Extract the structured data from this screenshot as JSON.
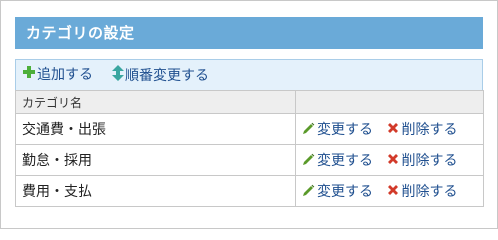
{
  "header": {
    "title": "カテゴリの設定"
  },
  "toolbar": {
    "add_label": "追加する",
    "order_label": "順番変更する"
  },
  "table": {
    "column_header": "カテゴリ名",
    "rows": [
      {
        "name": "交通費・出張",
        "edit_label": "変更する",
        "delete_label": "削除する"
      },
      {
        "name": "勤怠・採用",
        "edit_label": "変更する",
        "delete_label": "削除する"
      },
      {
        "name": "費用・支払",
        "edit_label": "変更する",
        "delete_label": "削除する"
      }
    ]
  },
  "icons": {
    "add": "plus-icon",
    "order": "updown-arrow-icon",
    "edit": "pencil-icon",
    "delete": "x-icon"
  },
  "colors": {
    "header_bg": "#6aaad8",
    "toolbar_bg": "#e4f1fb",
    "link": "#1f4f8f",
    "add_icon": "#4caf3a",
    "order_icon": "#3aa6a0",
    "edit_icon": "#5a9a2a",
    "delete_icon": "#d23a2a"
  }
}
